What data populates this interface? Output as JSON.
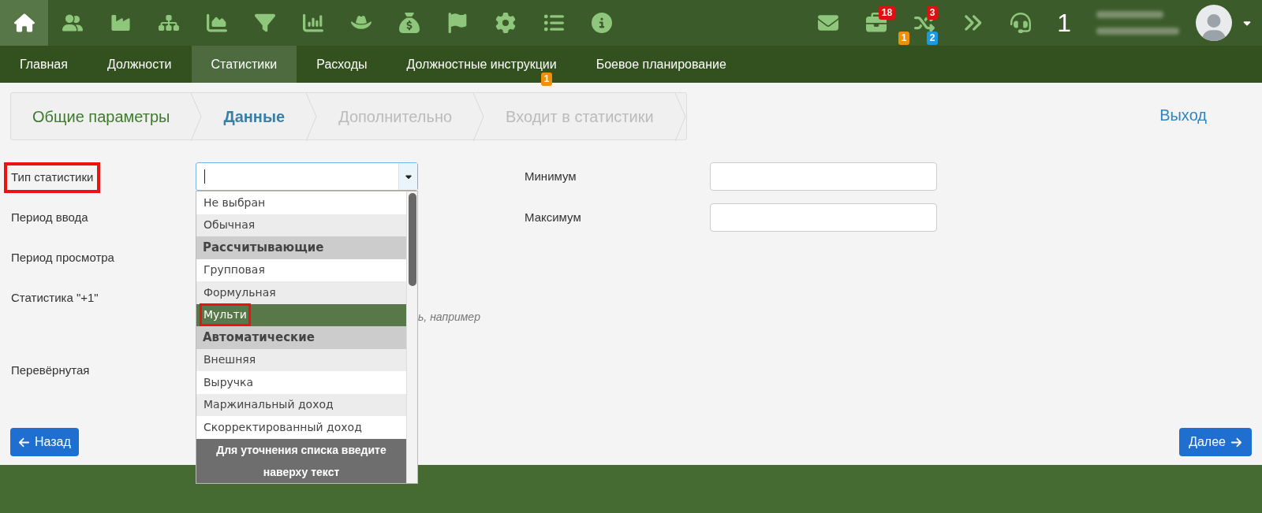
{
  "toolbar": {
    "icons": [
      {
        "kind": "home",
        "selected": true
      },
      {
        "kind": "users",
        "selected": false
      },
      {
        "kind": "factory",
        "selected": false
      },
      {
        "kind": "sitemap",
        "selected": false
      },
      {
        "kind": "chart-area",
        "selected": false
      },
      {
        "kind": "filter",
        "selected": false
      },
      {
        "kind": "chart-bar",
        "selected": false
      },
      {
        "kind": "hat",
        "selected": false
      },
      {
        "kind": "money-bag",
        "selected": false
      },
      {
        "kind": "flag",
        "selected": false
      },
      {
        "kind": "gear",
        "selected": false
      },
      {
        "kind": "list",
        "selected": false
      },
      {
        "kind": "info",
        "selected": false
      }
    ],
    "right_icons": [
      {
        "kind": "mail"
      },
      {
        "kind": "briefcase",
        "badge_top": {
          "text": "18",
          "color": "#e01010"
        }
      },
      {
        "kind": "shuffle",
        "badge_top": {
          "text": "3",
          "color": "#e01010"
        },
        "badge_bottom_left": {
          "text": "1",
          "color": "#f0900a"
        },
        "badge_bottom_right": {
          "text": "2",
          "color": "#1a9ae0"
        }
      },
      {
        "kind": "forward"
      },
      {
        "kind": "headset"
      }
    ],
    "counter": "1"
  },
  "nav": {
    "tabs": [
      {
        "label": "Главная",
        "selected": false
      },
      {
        "label": "Должности",
        "selected": false
      },
      {
        "label": "Статистики",
        "selected": true
      },
      {
        "label": "Расходы",
        "selected": false
      },
      {
        "label": "Должностные инструкции",
        "selected": false,
        "badge": "1"
      },
      {
        "label": "Боевое планирование",
        "selected": false
      }
    ]
  },
  "wizard": {
    "steps": [
      {
        "label": "Общие параметры",
        "completed": true,
        "current": false
      },
      {
        "label": "Данные",
        "completed": false,
        "current": true
      },
      {
        "label": "Дополнительно",
        "completed": false,
        "current": false
      },
      {
        "label": "Входит в статистики",
        "completed": false,
        "current": false
      }
    ],
    "exit": "Выход"
  },
  "form": {
    "left_fields": [
      {
        "label": "Тип статистики",
        "highlighted": true
      },
      {
        "label": "Период ввода",
        "highlighted": false
      },
      {
        "label": "Период просмотра",
        "highlighted": false
      },
      {
        "label": "Статистика \"+1\"",
        "highlighted": false
      },
      {
        "label": "Перевёрнутая",
        "highlighted": false
      }
    ],
    "hint": "ь, например",
    "right_fields": [
      {
        "label": "Минимум"
      },
      {
        "label": "Максимум"
      }
    ]
  },
  "dropdown": {
    "items": [
      {
        "kind": "option",
        "label": "Не выбран",
        "selected": false,
        "highlighted": false
      },
      {
        "kind": "option",
        "label": "Обычная",
        "selected": false,
        "highlighted": false
      },
      {
        "kind": "group",
        "label": "Рассчитывающие"
      },
      {
        "kind": "option",
        "label": "Групповая",
        "selected": false,
        "highlighted": false
      },
      {
        "kind": "option",
        "label": "Формульная",
        "selected": false,
        "highlighted": false
      },
      {
        "kind": "option",
        "label": "Мульти",
        "selected": true,
        "highlighted": true
      },
      {
        "kind": "group",
        "label": "Автоматические"
      },
      {
        "kind": "option",
        "label": "Внешняя",
        "selected": false,
        "highlighted": false
      },
      {
        "kind": "option",
        "label": "Выручка",
        "selected": false,
        "highlighted": false
      },
      {
        "kind": "option",
        "label": "Маржинальный доход",
        "selected": false,
        "highlighted": false
      },
      {
        "kind": "option",
        "label": "Скорректированный доход",
        "selected": false,
        "highlighted": false
      }
    ],
    "footer": "Для уточнения списка введите наверху текст"
  },
  "buttons": {
    "back": "Назад",
    "next": "Далее"
  }
}
